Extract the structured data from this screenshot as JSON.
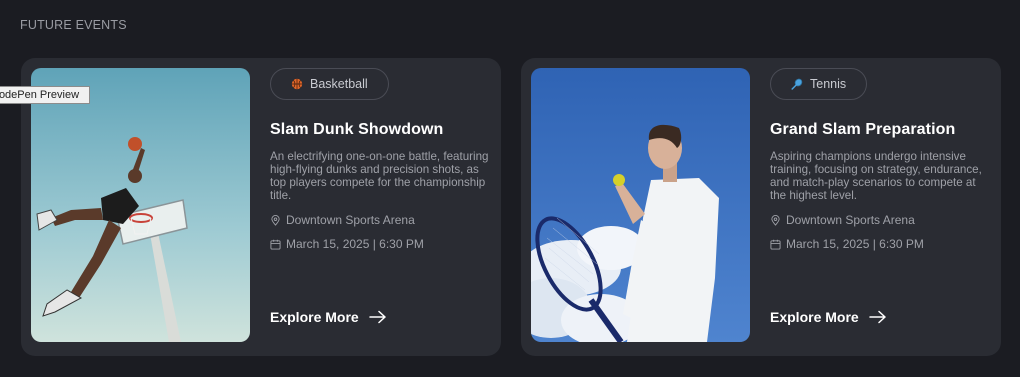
{
  "section": {
    "title": "FUTURE EVENTS"
  },
  "tooltip": {
    "text": "CodePen Preview"
  },
  "events": [
    {
      "tag": "Basketball",
      "tag_icon": "basketball-icon",
      "title": "Slam Dunk Showdown",
      "description": "An electrifying one-on-one battle, featuring high-flying dunks and precision shots, as top players compete for the championship title.",
      "location": "Downtown Sports Arena",
      "datetime": "March 15, 2025 | 6:30 PM",
      "cta": "Explore More",
      "image": "basketball-player-dunk-photo"
    },
    {
      "tag": "Tennis",
      "tag_icon": "tennis-racket-icon",
      "title": "Grand Slam Preparation",
      "description": "Aspiring champions undergo intensive training, focusing on strategy, endurance, and match-play scenarios to compete at the highest level.",
      "location": "Downtown Sports Arena",
      "datetime": "March 15, 2025 | 6:30 PM",
      "cta": "Explore More",
      "image": "tennis-player-photo"
    }
  ],
  "colors": {
    "background": "#1b1c22",
    "card": "#2a2c33",
    "accent_basketball": "#e0662a",
    "accent_tennis": "#4aa3df"
  }
}
